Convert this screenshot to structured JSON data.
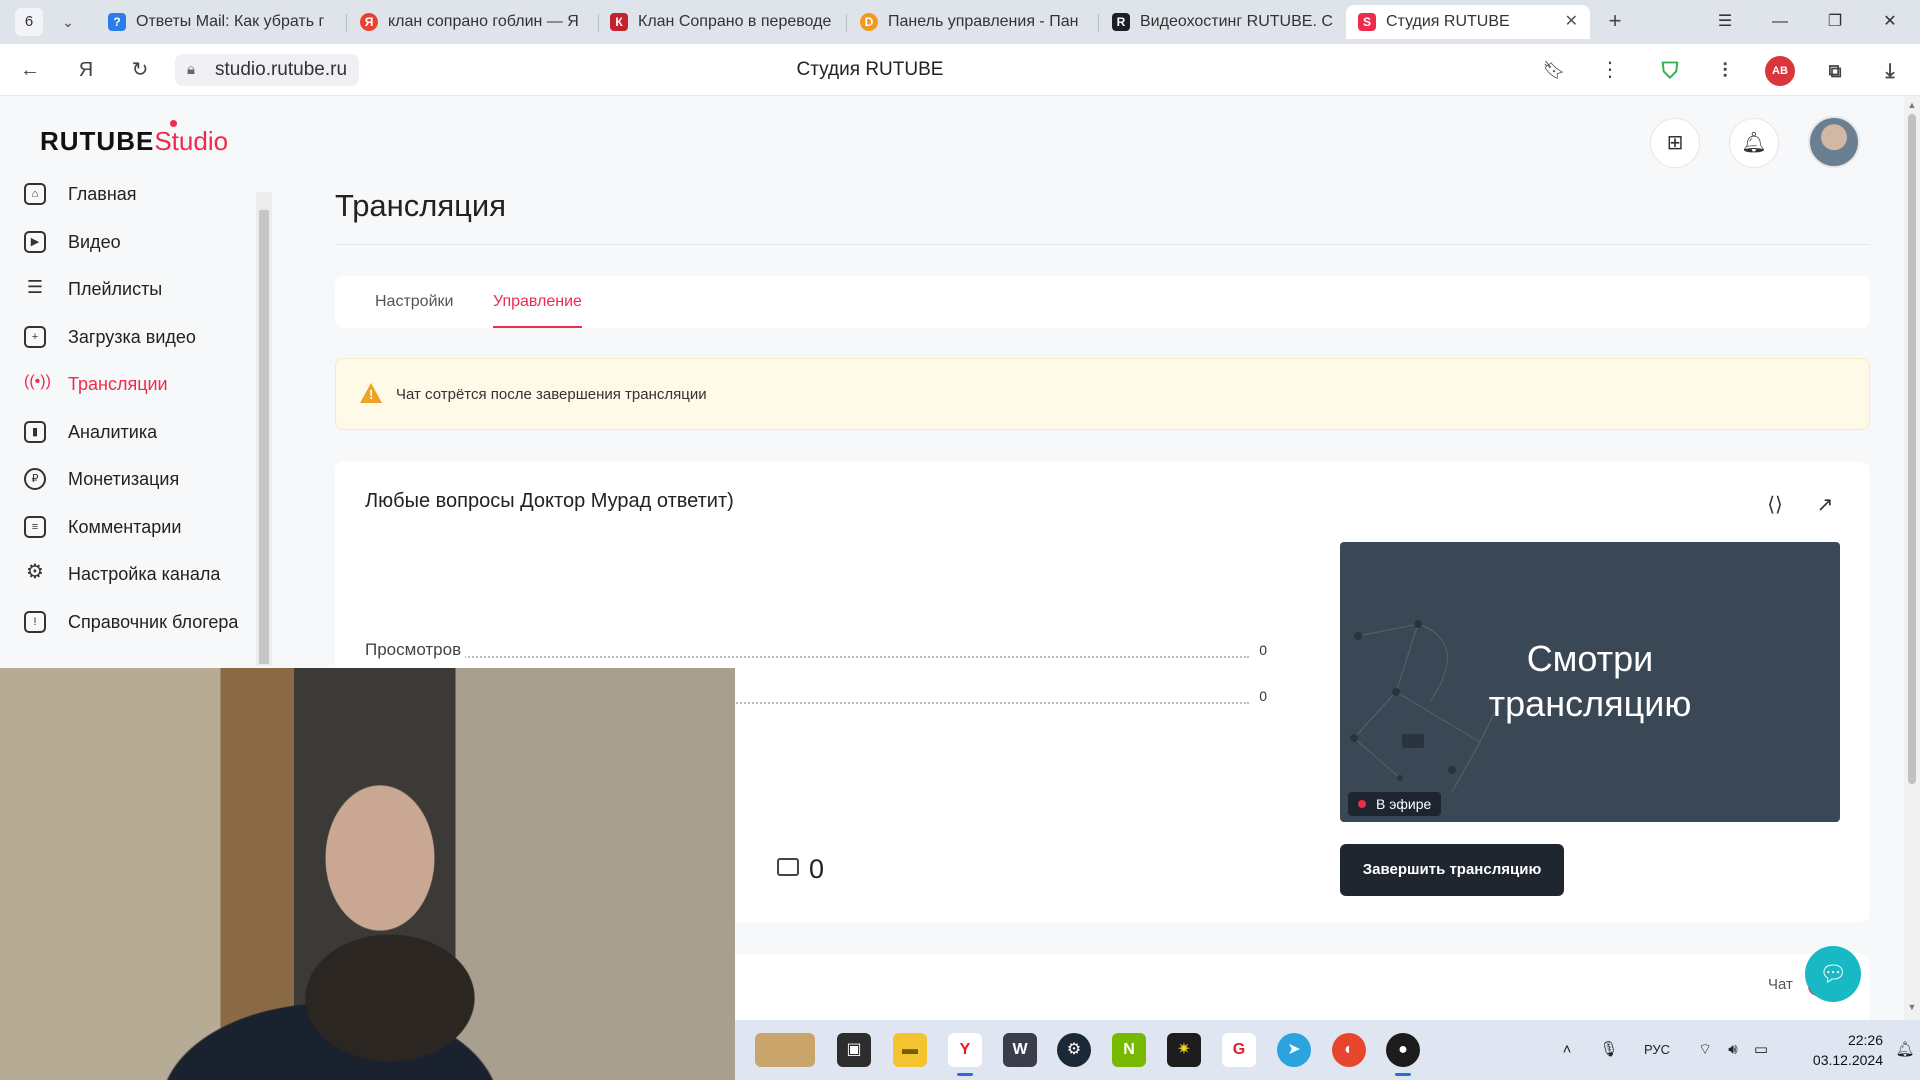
{
  "browser": {
    "tab_count": "6",
    "tabs": [
      {
        "title": "Ответы Mail: Как убрать г",
        "icon": "mail-answers-icon",
        "color": "#2b7de9"
      },
      {
        "title": "клан сопрано гоблин — Я",
        "icon": "yandex-search-icon",
        "color": "#e8412f"
      },
      {
        "title": "Клан Сопрано в переводе",
        "icon": "kinopoisk-icon",
        "color": "#c0232e"
      },
      {
        "title": "Панель управления - Пан",
        "icon": "panel-icon",
        "color": "#f29a1d"
      },
      {
        "title": "Видеохостинг RUTUBE. С",
        "icon": "rutube-icon",
        "color": "#1b1f2a"
      },
      {
        "title": "Студия RUTUBE",
        "icon": "rutube-studio-icon",
        "color": "#ef2a4a"
      }
    ],
    "url": "studio.rutube.ru",
    "page_title": "Студия RUTUBE"
  },
  "app": {
    "logo_main": "RUTUBE",
    "logo_sub": "Studio",
    "accent": "#ef2a4a"
  },
  "sidebar": {
    "items": [
      {
        "label": "Главная",
        "icon": "home-icon"
      },
      {
        "label": "Видео",
        "icon": "video-icon"
      },
      {
        "label": "Плейлисты",
        "icon": "playlist-icon"
      },
      {
        "label": "Загрузка видео",
        "icon": "upload-icon"
      },
      {
        "label": "Трансляции",
        "icon": "broadcast-icon",
        "active": true
      },
      {
        "label": "Аналитика",
        "icon": "analytics-icon"
      },
      {
        "label": "Монетизация",
        "icon": "ruble-icon"
      },
      {
        "label": "Комментарии",
        "icon": "comments-icon"
      },
      {
        "label": "Настройка канала",
        "icon": "gear-icon"
      },
      {
        "label": "Справочник блогера",
        "icon": "info-icon"
      }
    ]
  },
  "main": {
    "title": "Трансляция",
    "tabs": [
      {
        "label": "Настройки"
      },
      {
        "label": "Управление",
        "active": true
      }
    ],
    "alert": "Чат сотрётся после завершения трансляции",
    "stream": {
      "title": "Любые вопросы Доктор Мурад ответит)",
      "stats": [
        {
          "label": "Просмотров",
          "value": "0"
        },
        {
          "label": "",
          "value": "0"
        }
      ],
      "preview_text_line1": "Смотри",
      "preview_text_line2": "трансляцию",
      "live_badge": "В эфире",
      "dislikes": "0",
      "end_button": "Завершить трансляцию"
    },
    "chat": {
      "label": "Чат",
      "enabled": true
    }
  },
  "taskbar": {
    "language": "РУС",
    "time": "22:26",
    "date": "03.12.2024"
  }
}
